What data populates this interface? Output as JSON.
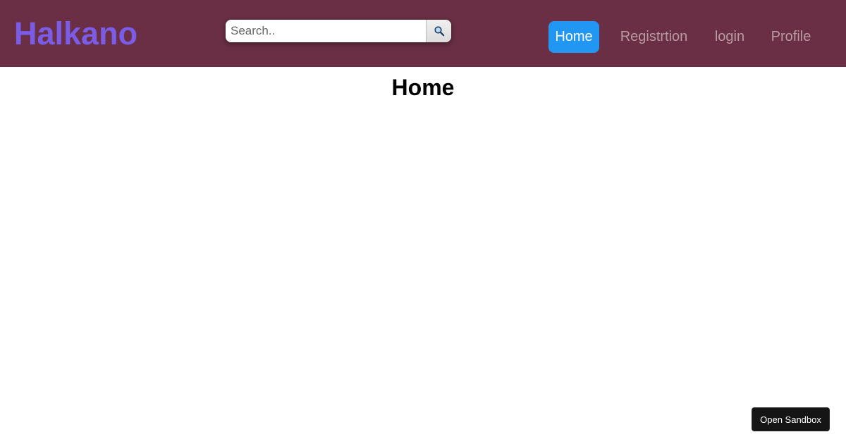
{
  "header": {
    "logo": "Halkano",
    "search": {
      "placeholder": "Search..",
      "value": "",
      "button_icon": "search-icon"
    },
    "nav": [
      {
        "label": "Home",
        "active": true
      },
      {
        "label": "Registrtion",
        "active": false
      },
      {
        "label": "login",
        "active": false
      },
      {
        "label": "Profile",
        "active": false
      }
    ]
  },
  "main": {
    "title": "Home"
  },
  "footer": {
    "sandbox_label": "Open Sandbox"
  },
  "colors": {
    "header_bg": "#6a2f44",
    "logo": "#7a5ce6",
    "nav_active_bg": "#2196f3",
    "nav_inactive_text": "#b79a9f"
  }
}
